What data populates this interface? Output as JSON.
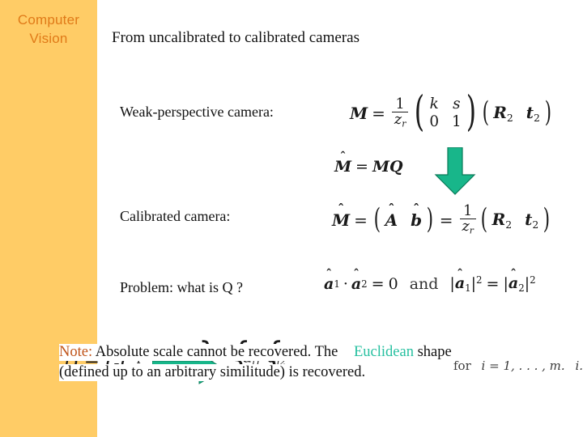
{
  "sidebar": {
    "title": "Computer Vision",
    "bg_color": "#ffcc66",
    "text_color": "#e07a18"
  },
  "slide": {
    "title": "From uncalibrated to calibrated cameras",
    "background": "#ffffff"
  },
  "labels": {
    "weak_perspective": "Weak-perspective camera:",
    "calibrated": "Calibrated camera:",
    "problem": "Problem: what is Q ?"
  },
  "equations": {
    "weak_perspective": {
      "lhs": "M",
      "equals": "=",
      "fraction_num": "1",
      "fraction_den": "z",
      "fraction_den_sub": "r",
      "matrix": [
        "k",
        "s",
        "0",
        "1"
      ],
      "rowvec": [
        "R",
        "t"
      ],
      "rowvec_subs": [
        "2",
        "2"
      ],
      "plain": "M = (1/z_r) ( k s ; 0 1 ) ( R_2  t_2 )"
    },
    "transform": {
      "plain": "M̂ = M Q",
      "lhs": "M",
      "hat": "ˆ",
      "equals": "=",
      "rhs1": "M",
      "rhs2": "Q"
    },
    "calibrated": {
      "plain": "M̂ = ( Â  b̂ ) = (1/z_r) ( R_2  t_2 )",
      "lhs": "M",
      "a": "A",
      "b": "b",
      "fraction_num": "1",
      "fraction_den": "z",
      "fraction_den_sub": "r",
      "rowvec": [
        "R",
        "t"
      ],
      "rowvec_subs": [
        "2",
        "2"
      ]
    },
    "constraints": {
      "plain": "â1 · â2 = 0  and  |â1|² = |â2|²",
      "a": "a",
      "sub1": "1",
      "sub2": "2",
      "dot": "·",
      "zero": "0",
      "and": "and",
      "sup": "2"
    },
    "ghost": {
      "d_equation": "D = GC",
      "d_sup": "T",
      "for_clause": "for",
      "index_range": "i = 1, . . . , m.",
      "trailing": "i."
    }
  },
  "note": {
    "keyword": "Note:",
    "keyword_color": "#c0541a",
    "line1_part1": "Absolute scale cannot be recovered. The",
    "highlight": "Euclidean",
    "highlight_color": "#27c0a0",
    "line1_part2": "shape",
    "line2": "(defined up to an arbitrary similitude) is recovered."
  },
  "arrows": {
    "down": {
      "name": "down-arrow",
      "color": "#18b68a"
    },
    "right": {
      "name": "right-arrow",
      "color": "#18b68a"
    }
  }
}
